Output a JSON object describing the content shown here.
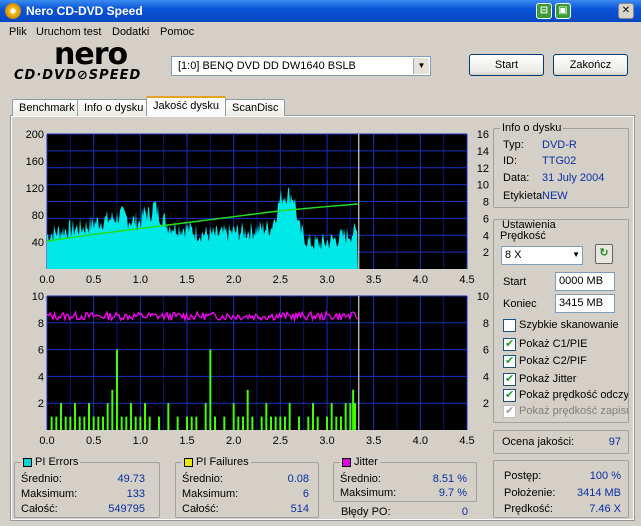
{
  "window": {
    "title": "Nero CD-DVD Speed"
  },
  "menu": [
    "Plik",
    "Uruchom test",
    "Dodatki",
    "Pomoc"
  ],
  "logo": {
    "main": "nero",
    "sub": "CD·DVD⊘SPEED"
  },
  "drive": {
    "selected": "[1:0]  BENQ DVD DD DW1640 BSLB"
  },
  "buttons": {
    "start": "Start",
    "stop": "Zakończ"
  },
  "tabs": [
    "Benchmark",
    "Info o dysku",
    "Jakość dysku",
    "ScanDisc"
  ],
  "disc_info": {
    "title": "Info o dysku",
    "rows": [
      {
        "label": "Typ:",
        "value": "DVD-R"
      },
      {
        "label": "ID:",
        "value": "TTG02"
      },
      {
        "label": "Data:",
        "value": "31 July 2004"
      },
      {
        "label": "Etykieta",
        "value": "NEW"
      }
    ]
  },
  "settings": {
    "title": "Ustawienia",
    "speed_label": "Prędkość",
    "speed_value": "8 X",
    "start_label": "Start",
    "start_value": "0000 MB",
    "end_label": "Koniec",
    "end_value": "3415 MB",
    "checkboxes": [
      {
        "label": "Szybkie skanowanie",
        "checked": false,
        "disabled": false
      },
      {
        "label": "Pokaż C1/PIE",
        "checked": true,
        "disabled": false
      },
      {
        "label": "Pokaż C2/PIF",
        "checked": true,
        "disabled": false
      },
      {
        "label": "Pokaż Jitter",
        "checked": true,
        "disabled": false
      },
      {
        "label": "Pokaż prędkość odczytu",
        "checked": true,
        "disabled": false
      },
      {
        "label": "Pokaż prędkość zapisu",
        "checked": true,
        "disabled": true
      }
    ]
  },
  "quality": {
    "label": "Ocena jakości:",
    "value": "97"
  },
  "pi_errors": {
    "title": "PI Errors",
    "color": "#00d8d8",
    "rows": [
      {
        "label": "Średnio:",
        "value": "49.73"
      },
      {
        "label": "Maksimum:",
        "value": "133"
      },
      {
        "label": "Całość:",
        "value": "549795"
      }
    ]
  },
  "pi_failures": {
    "title": "PI Failures",
    "color": "#e8e800",
    "rows": [
      {
        "label": "Średnio:",
        "value": "0.08"
      },
      {
        "label": "Maksimum:",
        "value": "6"
      },
      {
        "label": "Całość:",
        "value": "514"
      }
    ]
  },
  "jitter": {
    "title": "Jitter",
    "color": "#e000e0",
    "rows": [
      {
        "label": "Średnio:",
        "value": "8.51 %"
      },
      {
        "label": "Maksimum:",
        "value": "9.7 %"
      }
    ]
  },
  "po_errors": {
    "label": "Błędy PO:",
    "value": "0"
  },
  "progress": {
    "rows": [
      {
        "label": "Postęp:",
        "value": "100 %"
      },
      {
        "label": "Położenie:",
        "value": "3414 MB"
      },
      {
        "label": "Prędkość:",
        "value": "7.46 X"
      }
    ]
  },
  "chart_data": [
    {
      "type": "area",
      "series": [
        {
          "name": "PI Errors",
          "color": "#00e8e8"
        },
        {
          "name": "read speed",
          "color": "#20e020"
        }
      ],
      "x_ticks": [
        "0.0",
        "0.5",
        "1.0",
        "1.5",
        "2.0",
        "2.5",
        "3.0",
        "3.5",
        "4.0",
        "4.5"
      ],
      "y_left_ticks": [
        "200",
        "160",
        "120",
        "80",
        "40"
      ],
      "y_right_ticks": [
        "16",
        "14",
        "12",
        "10",
        "8",
        "6",
        "4",
        "2"
      ],
      "xlim": [
        0,
        4.5
      ],
      "ylim_left": [
        0,
        200
      ],
      "ylim_right": [
        0,
        16
      ],
      "scan_end_x": 3.33,
      "pi_errors_profile": [
        [
          0,
          50
        ],
        [
          0.1,
          55
        ],
        [
          0.2,
          58
        ],
        [
          0.3,
          60
        ],
        [
          0.4,
          62
        ],
        [
          0.5,
          68
        ],
        [
          0.6,
          72
        ],
        [
          0.7,
          75
        ],
        [
          0.8,
          80
        ],
        [
          0.9,
          72
        ],
        [
          1.0,
          70
        ],
        [
          1.05,
          85
        ],
        [
          1.1,
          80
        ],
        [
          1.15,
          95
        ],
        [
          1.2,
          82
        ],
        [
          1.3,
          65
        ],
        [
          1.4,
          62
        ],
        [
          1.5,
          60
        ],
        [
          1.6,
          55
        ],
        [
          1.7,
          52
        ],
        [
          1.8,
          50
        ],
        [
          1.9,
          52
        ],
        [
          2.0,
          55
        ],
        [
          2.1,
          55
        ],
        [
          2.2,
          57
        ],
        [
          2.3,
          60
        ],
        [
          2.4,
          62
        ],
        [
          2.45,
          80
        ],
        [
          2.5,
          105
        ],
        [
          2.55,
          110
        ],
        [
          2.6,
          112
        ],
        [
          2.65,
          105
        ],
        [
          2.7,
          60
        ],
        [
          2.8,
          40
        ],
        [
          2.9,
          38
        ],
        [
          3.0,
          40
        ],
        [
          3.1,
          45
        ],
        [
          3.2,
          50
        ],
        [
          3.3,
          55
        ],
        [
          3.33,
          55
        ]
      ],
      "read_speed": [
        [
          0,
          3.3
        ],
        [
          0.5,
          4.1
        ],
        [
          1.0,
          4.8
        ],
        [
          1.5,
          5.5
        ],
        [
          2.0,
          6.2
        ],
        [
          2.5,
          6.9
        ],
        [
          3.0,
          7.4
        ],
        [
          3.33,
          7.7
        ]
      ]
    },
    {
      "type": "bar",
      "series": [
        {
          "name": "PI Failures",
          "color": "#40ff00"
        },
        {
          "name": "Jitter",
          "color": "#ff00ff"
        }
      ],
      "x_ticks": [
        "0.0",
        "0.5",
        "1.0",
        "1.5",
        "2.0",
        "2.5",
        "3.0",
        "3.5",
        "4.0",
        "4.5"
      ],
      "y_left_ticks": [
        "10",
        "8",
        "6",
        "4",
        "2"
      ],
      "y_right_ticks": [
        "10",
        "8",
        "6",
        "4",
        "2"
      ],
      "xlim": [
        0,
        4.5
      ],
      "ylim": [
        0,
        10
      ],
      "scan_end_x": 3.33,
      "jitter_mean": 8.5,
      "pi_failures": [
        [
          0.05,
          1
        ],
        [
          0.1,
          1
        ],
        [
          0.15,
          2
        ],
        [
          0.2,
          1
        ],
        [
          0.25,
          1
        ],
        [
          0.3,
          2
        ],
        [
          0.35,
          1
        ],
        [
          0.4,
          1
        ],
        [
          0.45,
          2
        ],
        [
          0.5,
          1
        ],
        [
          0.55,
          1
        ],
        [
          0.6,
          1
        ],
        [
          0.65,
          2
        ],
        [
          0.7,
          3
        ],
        [
          0.75,
          6
        ],
        [
          0.8,
          1
        ],
        [
          0.85,
          1
        ],
        [
          0.9,
          2
        ],
        [
          0.95,
          1
        ],
        [
          1.0,
          1
        ],
        [
          1.05,
          2
        ],
        [
          1.1,
          1
        ],
        [
          1.2,
          1
        ],
        [
          1.3,
          2
        ],
        [
          1.4,
          1
        ],
        [
          1.5,
          1
        ],
        [
          1.55,
          1
        ],
        [
          1.6,
          1
        ],
        [
          1.7,
          2
        ],
        [
          1.75,
          6
        ],
        [
          1.8,
          1
        ],
        [
          1.9,
          1
        ],
        [
          2.0,
          2
        ],
        [
          2.05,
          1
        ],
        [
          2.1,
          1
        ],
        [
          2.15,
          3
        ],
        [
          2.2,
          1
        ],
        [
          2.3,
          1
        ],
        [
          2.35,
          2
        ],
        [
          2.4,
          1
        ],
        [
          2.45,
          1
        ],
        [
          2.5,
          1
        ],
        [
          2.55,
          1
        ],
        [
          2.6,
          2
        ],
        [
          2.7,
          1
        ],
        [
          2.8,
          1
        ],
        [
          2.85,
          2
        ],
        [
          2.9,
          1
        ],
        [
          3.0,
          1
        ],
        [
          3.05,
          2
        ],
        [
          3.1,
          1
        ],
        [
          3.15,
          1
        ],
        [
          3.2,
          2
        ],
        [
          3.25,
          2
        ],
        [
          3.28,
          3
        ],
        [
          3.3,
          2
        ]
      ]
    }
  ]
}
